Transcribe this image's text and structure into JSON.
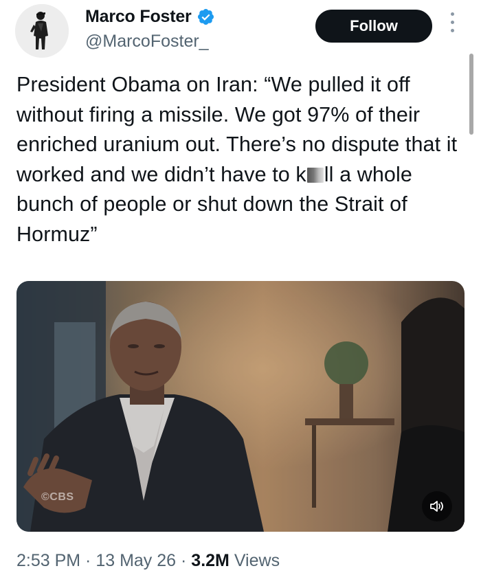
{
  "author": {
    "display_name": "Marco Foster",
    "handle": "@MarcoFoster_",
    "verified_icon": "verified-badge-icon",
    "verified_color": "#1d9bf0"
  },
  "actions": {
    "follow_label": "Follow",
    "more_icon": "more-vertical-icon"
  },
  "tweet": {
    "text_before_censor": "President Obama on Iran: “We pulled it off without firing a missile. We got 97% of their enriched uranium out. There’s no dispute that it worked and we didn’t have to k",
    "text_after_censor": "ll a whole bunch of people or shut down the Strait of Hormuz”"
  },
  "media": {
    "watermark": "©CBS",
    "mute_icon": "speaker-volume-icon"
  },
  "meta": {
    "time": "2:53 PM",
    "separator1": " · ",
    "date": "13 May 26",
    "separator2": " · ",
    "views_count": "3.2M",
    "views_label": " Views"
  }
}
